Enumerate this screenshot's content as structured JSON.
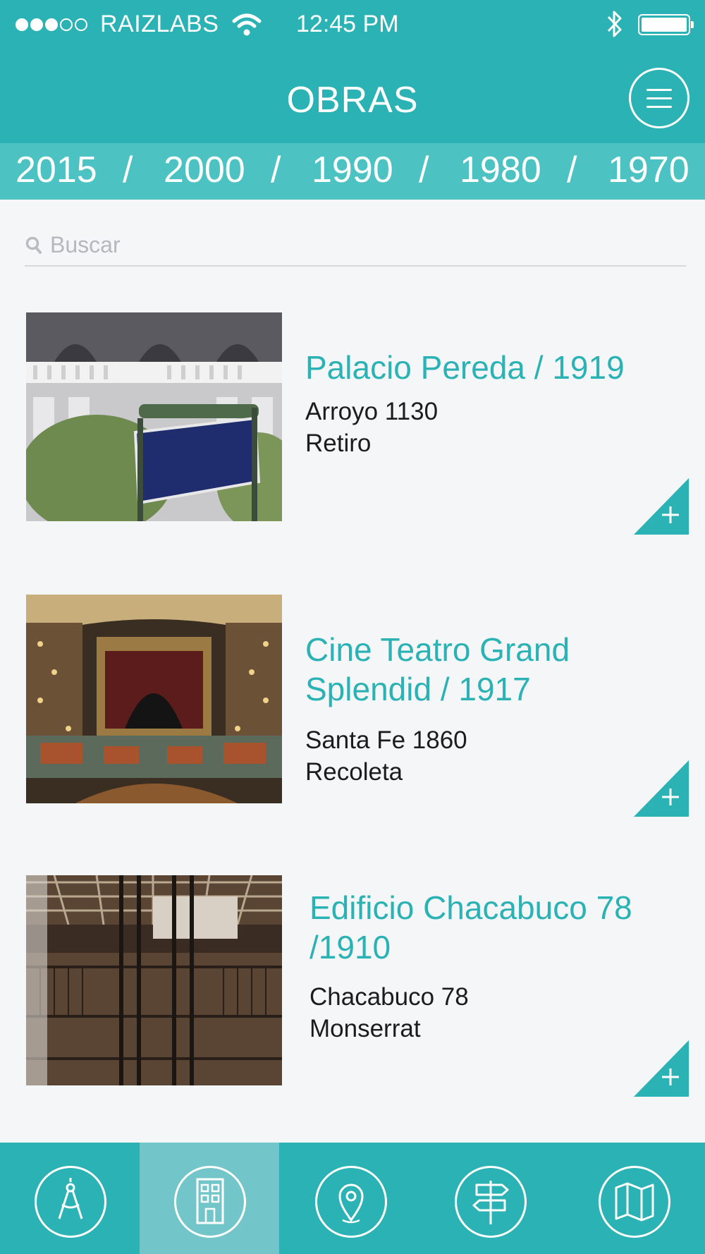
{
  "status_bar": {
    "carrier": "RAIZLABS",
    "time": "12:45 PM",
    "signal_bars_filled": 3,
    "signal_bars_total": 5
  },
  "header": {
    "title": "OBRAS",
    "menu_icon": "hamburger-menu-icon"
  },
  "year_filter": {
    "years": [
      "2015",
      "2000",
      "1990",
      "1980",
      "1970"
    ],
    "separator": "/"
  },
  "search": {
    "placeholder": "Buscar",
    "value": ""
  },
  "works": [
    {
      "title": "Palacio Pereda / 1919",
      "address": "Arroyo 1130",
      "neighborhood": "Retiro"
    },
    {
      "title": "Cine Teatro Grand Splendid / 1917",
      "address": "Santa Fe 1860",
      "neighborhood": "Recoleta"
    },
    {
      "title": "Edificio Chacabuco 78 /1910",
      "address": "Chacabuco 78",
      "neighborhood": "Monserrat"
    }
  ],
  "tabs": [
    {
      "icon": "compass-drafting-icon",
      "active": false
    },
    {
      "icon": "building-icon",
      "active": true
    },
    {
      "icon": "location-pin-icon",
      "active": false
    },
    {
      "icon": "signpost-icon",
      "active": false
    },
    {
      "icon": "map-icon",
      "active": false
    }
  ],
  "colors": {
    "primary": "#2bb2b5",
    "year_bar": "#4cc2c2",
    "active_tab": "#72c5c8",
    "background": "#f5f6f8"
  }
}
